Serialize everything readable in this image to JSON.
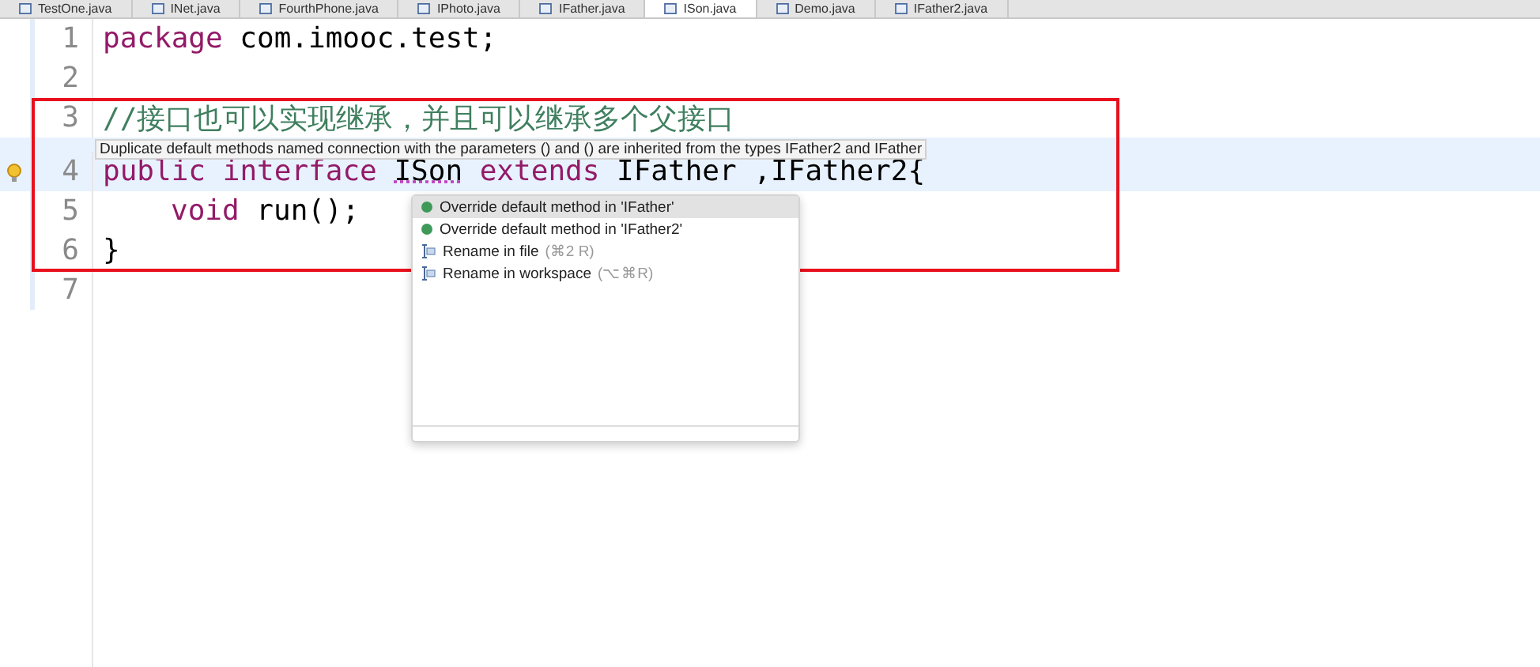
{
  "tabs": [
    {
      "label": "TestOne.java",
      "selected": false
    },
    {
      "label": "INet.java",
      "selected": false
    },
    {
      "label": "FourthPhone.java",
      "selected": false
    },
    {
      "label": "IPhoto.java",
      "selected": false
    },
    {
      "label": "IFather.java",
      "selected": false
    },
    {
      "label": "ISon.java",
      "selected": true
    },
    {
      "label": "Demo.java",
      "selected": false
    },
    {
      "label": "IFather2.java",
      "selected": false
    }
  ],
  "editor": {
    "lines": [
      {
        "number": "1",
        "current": false,
        "warning": false,
        "indented": false,
        "tokens": [
          {
            "kind": "keyword",
            "text": "package"
          },
          {
            "kind": "plain",
            "text": "com.imooc.test;"
          }
        ]
      },
      {
        "number": "2",
        "current": false,
        "warning": false
      },
      {
        "number": "3",
        "current": false,
        "warning": false,
        "indented": false,
        "tokens": [
          {
            "kind": "comment",
            "text": "//接口也可以实现继承，并且可以继承多个父接口"
          }
        ]
      },
      {
        "number": "4",
        "current": true,
        "warning": true,
        "indented": false,
        "tokens": [
          {
            "kind": "keyword",
            "text": "public interface"
          },
          {
            "kind": "error",
            "text": "ISon"
          },
          {
            "kind": "keyword",
            "text": "extends"
          },
          {
            "kind": "plain",
            "text": "IFather ,IFather2{"
          }
        ]
      },
      {
        "number": "5",
        "current": false,
        "warning": false,
        "indented": true,
        "tokens": [
          {
            "kind": "keyword",
            "text": "void"
          },
          {
            "kind": "plain",
            "text": "run();"
          }
        ]
      },
      {
        "number": "6",
        "current": false,
        "warning": false,
        "indented": false,
        "tokens": [
          {
            "kind": "plain",
            "text": "}"
          }
        ]
      },
      {
        "number": "7",
        "current": false,
        "warning": false
      }
    ]
  },
  "tooltip": {
    "text": "Duplicate default methods named connection with the parameters () and () are inherited from the types IFather2 and IFather"
  },
  "quick_fix": {
    "items": [
      {
        "kind": "override",
        "label": "Override default method in 'IFather'",
        "selected": true
      },
      {
        "kind": "override",
        "label": "Override default method in 'IFather2'",
        "selected": false
      },
      {
        "kind": "rename",
        "label": "Rename in file",
        "shortcut": "(⌘2 R)",
        "selected": false
      },
      {
        "kind": "rename",
        "label": "Rename in workspace",
        "shortcut": "(⌥⌘R)",
        "selected": false
      }
    ]
  }
}
